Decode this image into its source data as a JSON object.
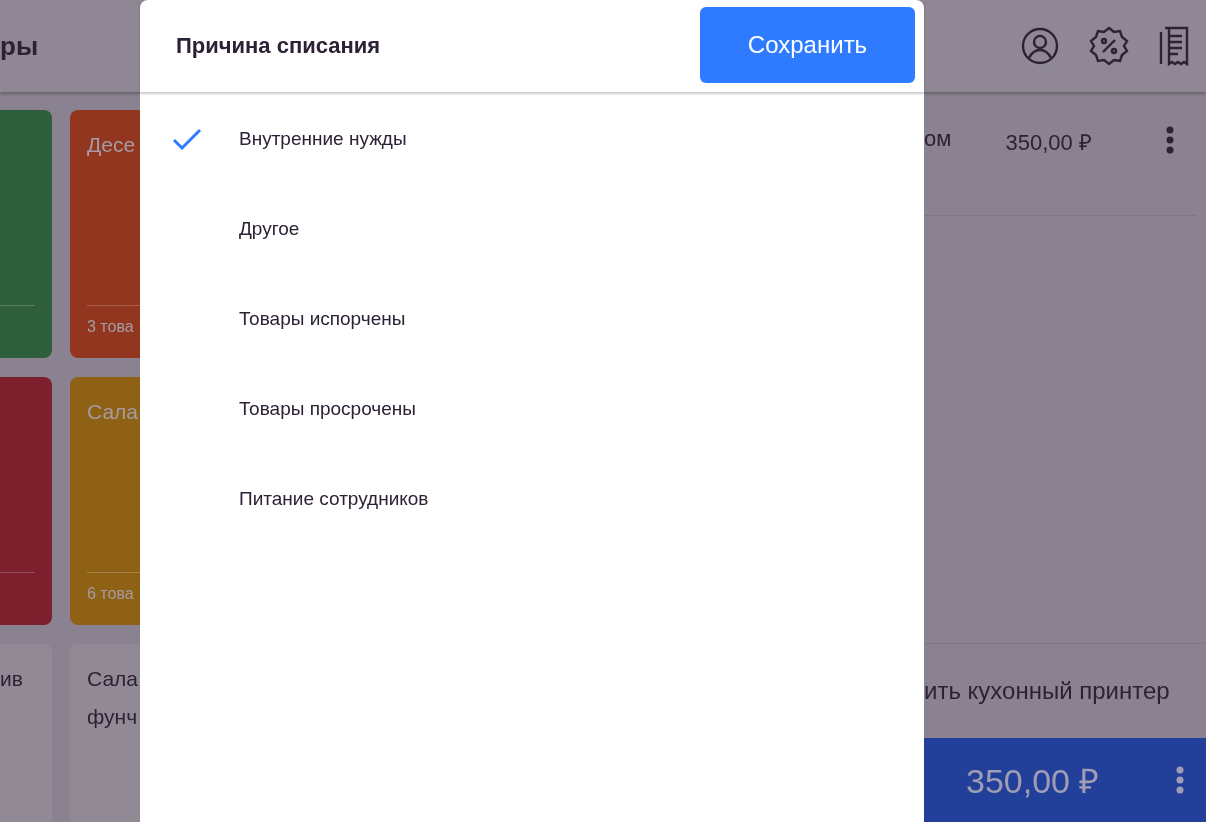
{
  "background": {
    "header_title": "ры",
    "tiles": [
      {
        "color": "#2f5e3b"
      },
      {
        "title": "Десе",
        "count": "3 това",
        "color": "#93361f"
      },
      {
        "color": "#7e1f2e"
      },
      {
        "title": "Сала",
        "count": "6 това",
        "color": "#8f6114"
      },
      {
        "title": "ив",
        "color": "#918a95"
      },
      {
        "title": "Сала\nфунч",
        "color": "#918a95"
      }
    ],
    "order_item": {
      "name": "ом",
      "price": "350,00 ₽"
    },
    "action": "ить кухонный принтер",
    "total": "350,00 ₽"
  },
  "dialog": {
    "title": "Причина списания",
    "save_button": "Сохранить",
    "reasons": [
      {
        "label": "Внутренние нужды",
        "selected": true
      },
      {
        "label": "Другое",
        "selected": false
      },
      {
        "label": "Товары испорчены",
        "selected": false
      },
      {
        "label": "Товары просрочены",
        "selected": false
      },
      {
        "label": "Питание сотрудников",
        "selected": false
      }
    ]
  }
}
